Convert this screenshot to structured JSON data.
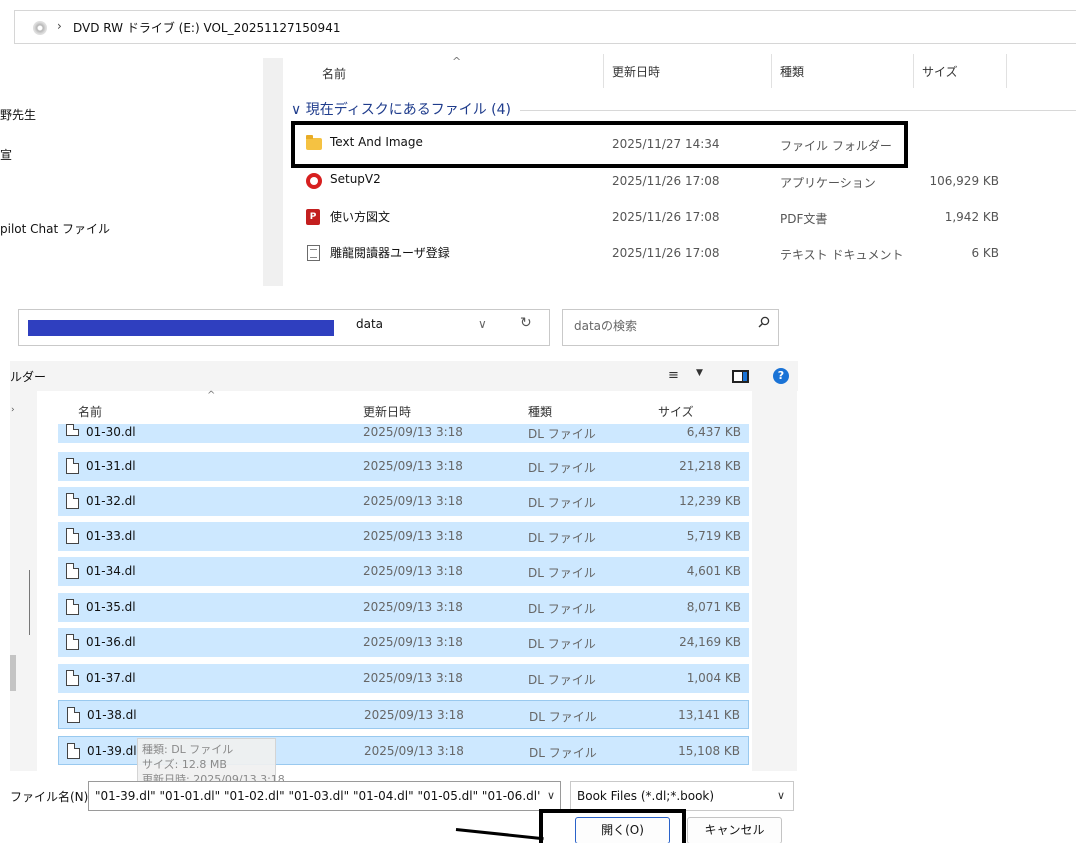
{
  "explorer": {
    "breadcrumb_chevron": "›",
    "breadcrumb": "DVD RW ドライブ (E:) VOL_20251127150941",
    "left_nav": [
      "野先生",
      "宣",
      "pilot Chat ファイル"
    ],
    "columns": {
      "name": "名前",
      "modified": "更新日時",
      "type": "種類",
      "size": "サイズ"
    },
    "sort_caret": "^",
    "group_label": "∨ 現在ディスクにあるファイル (4)",
    "files": [
      {
        "name": "Text And Image",
        "modified": "2025/11/27 14:34",
        "type": "ファイル フォルダー",
        "size": "",
        "icon": "folder-icon"
      },
      {
        "name": "SetupV2",
        "modified": "2025/11/26 17:08",
        "type": "アプリケーション",
        "size": "106,929 KB",
        "icon": "setup-app-icon"
      },
      {
        "name": "使い方図文",
        "modified": "2025/11/26 17:08",
        "type": "PDF文書",
        "size": "1,942 KB",
        "icon": "pdf-icon"
      },
      {
        "name": "雕龍閱讀器ユーザ登録",
        "modified": "2025/11/26 17:08",
        "type": "テキスト ドキュメント",
        "size": "6 KB",
        "icon": "text-document-icon"
      }
    ]
  },
  "dialog": {
    "path": "data",
    "path_dropdown": "∨",
    "refresh_symbol": "↻",
    "search_placeholder": "dataの検索",
    "toolbar_label": "ルダー",
    "view_symbol": "≡",
    "view_dropdown": "▼",
    "help_symbol": "?",
    "nav_chevron": "›",
    "columns": {
      "name": "名前",
      "modified": "更新日時",
      "type": "種類",
      "size": "サイズ"
    },
    "sort_caret": "^",
    "rows": [
      {
        "name": "01-30.dl",
        "modified": "2025/09/13 3:18",
        "type": "DL ファイル",
        "size": "6,437 KB"
      },
      {
        "name": "01-31.dl",
        "modified": "2025/09/13 3:18",
        "type": "DL ファイル",
        "size": "21,218 KB"
      },
      {
        "name": "01-32.dl",
        "modified": "2025/09/13 3:18",
        "type": "DL ファイル",
        "size": "12,239 KB"
      },
      {
        "name": "01-33.dl",
        "modified": "2025/09/13 3:18",
        "type": "DL ファイル",
        "size": "5,719 KB"
      },
      {
        "name": "01-34.dl",
        "modified": "2025/09/13 3:18",
        "type": "DL ファイル",
        "size": "4,601 KB"
      },
      {
        "name": "01-35.dl",
        "modified": "2025/09/13 3:18",
        "type": "DL ファイル",
        "size": "8,071 KB"
      },
      {
        "name": "01-36.dl",
        "modified": "2025/09/13 3:18",
        "type": "DL ファイル",
        "size": "24,169 KB"
      },
      {
        "name": "01-37.dl",
        "modified": "2025/09/13 3:18",
        "type": "DL ファイル",
        "size": "1,004 KB"
      },
      {
        "name": "01-38.dl",
        "modified": "2025/09/13 3:18",
        "type": "DL ファイル",
        "size": "13,141 KB"
      },
      {
        "name": "01-39.dl",
        "modified": "2025/09/13 3:18",
        "type": "DL ファイル",
        "size": "15,108 KB"
      }
    ],
    "tooltip": {
      "type": "種類: DL ファイル",
      "size": "サイズ: 12.8 MB",
      "modified": "更新日時: 2025/09/13 3:18"
    },
    "filename_label": "ファイル名(N):",
    "filename_value": "\"01-39.dl\" \"01-01.dl\" \"01-02.dl\" \"01-03.dl\" \"01-04.dl\" \"01-05.dl\" \"01-06.dl\"",
    "filename_dropdown": "∨",
    "filetype_value": "Book Files (*.dl;*.book)",
    "filetype_dropdown": "∨",
    "open_button": "開く(O)",
    "cancel_button": "キャンセル"
  },
  "colors": {
    "selection": "#cde8ff",
    "group_header": "#1f3c8c",
    "accent": "#1a73d6",
    "redaction": "#2f3fbf"
  }
}
